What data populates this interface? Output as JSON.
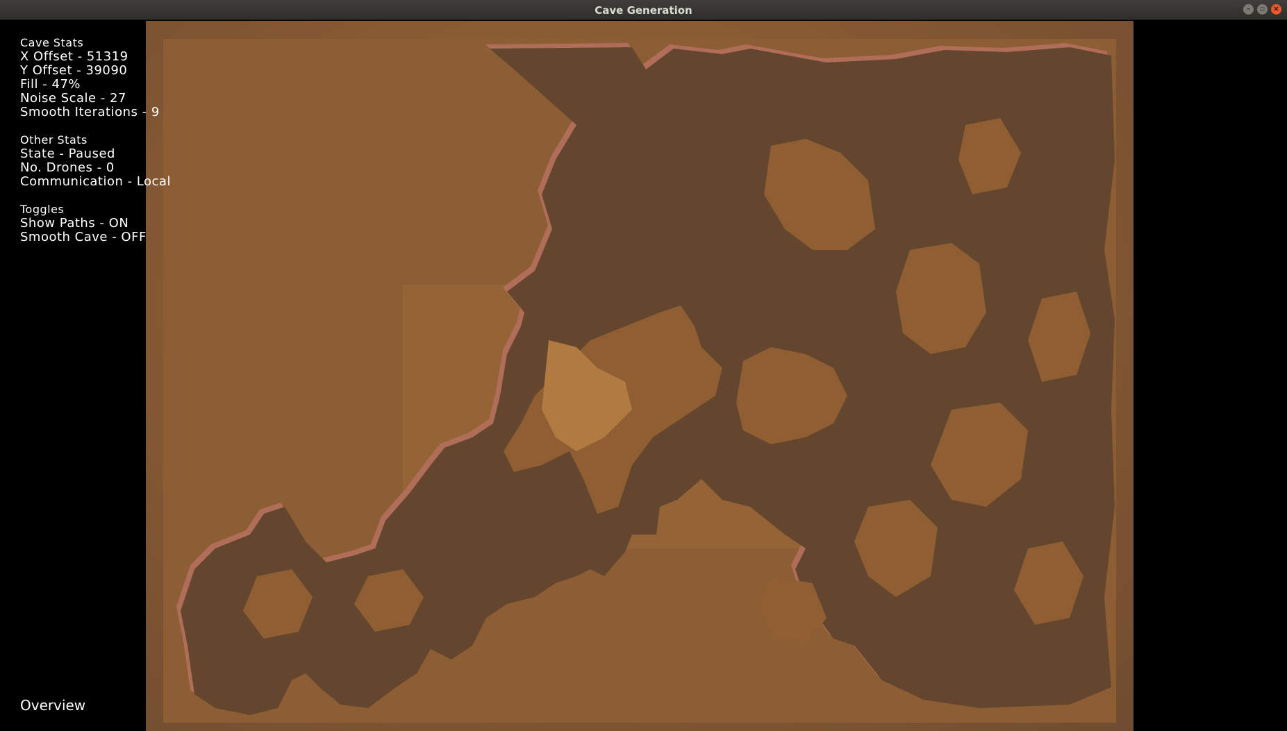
{
  "window": {
    "title": "Cave Generation",
    "buttons": [
      "minimize",
      "maximize",
      "close"
    ]
  },
  "cave_stats": {
    "heading": "Cave Stats",
    "x_offset": "X Offset - 51319",
    "y_offset": "Y Offset - 39090",
    "fill": "Fill - 47%",
    "noise_scale": "Noise Scale - 27",
    "smooth_iterations": "Smooth Iterations - 9"
  },
  "other_stats": {
    "heading": "Other Stats",
    "state": "State - Paused",
    "drones": "No. Drones - 0",
    "communication": "Communication - Local"
  },
  "toggles": {
    "heading": "Toggles",
    "show_paths": "Show Paths - ON",
    "smooth_cave": "Smooth Cave - OFF"
  },
  "view_label": "Overview",
  "colors": {
    "floor": "#8f5f33",
    "cave_wall": "#64462f",
    "wall_edge": "#b06e58",
    "background": "#000000"
  }
}
